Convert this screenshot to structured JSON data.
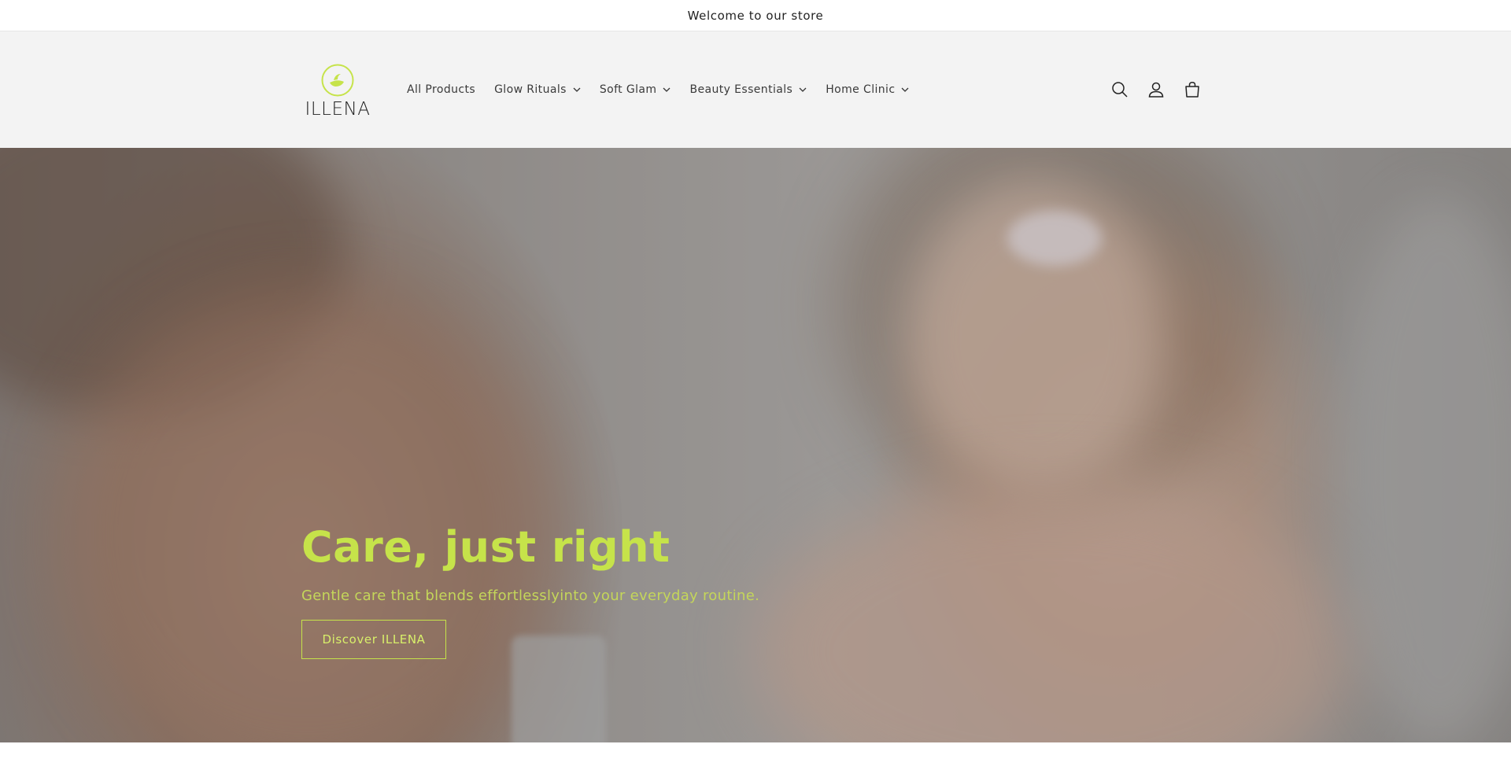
{
  "announcement": {
    "text": "Welcome to our store"
  },
  "brand": {
    "name": "ILLENA",
    "accent": "#c6e34a"
  },
  "nav": {
    "items": [
      {
        "label": "All Products",
        "has_dropdown": false
      },
      {
        "label": "Glow Rituals",
        "has_dropdown": true
      },
      {
        "label": "Soft Glam",
        "has_dropdown": true
      },
      {
        "label": "Beauty Essentials",
        "has_dropdown": true
      },
      {
        "label": "Home Clinic",
        "has_dropdown": true
      }
    ]
  },
  "header_icons": [
    "search-icon",
    "account-icon",
    "cart-icon"
  ],
  "hero": {
    "title": "Care, just right",
    "subtitle": "Gentle care that blends effortlesslyinto your everyday routine.",
    "button_label": "Discover ILLENA"
  }
}
